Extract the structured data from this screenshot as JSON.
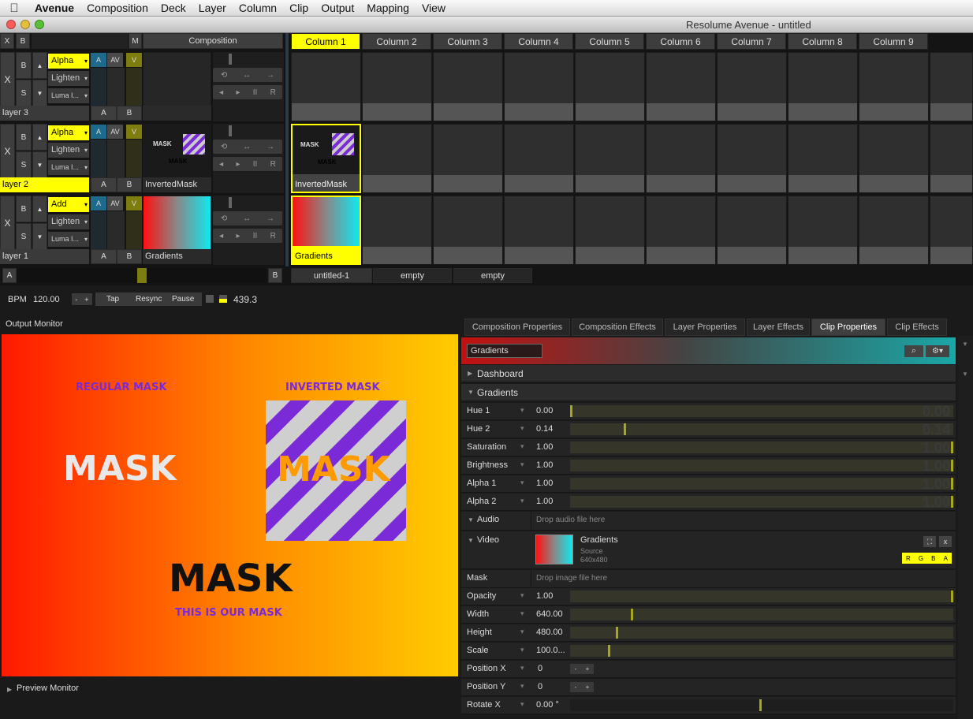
{
  "menubar": {
    "apple_icon": "",
    "app": "Avenue",
    "items": [
      "Composition",
      "Deck",
      "Layer",
      "Column",
      "Clip",
      "Output",
      "Mapping",
      "View"
    ]
  },
  "window": {
    "title": "Resolume Avenue - untitled"
  },
  "deck": {
    "left_header": {
      "x": "X",
      "b": "B",
      "m": "M",
      "composition": "Composition"
    },
    "columns": [
      "Column 1",
      "Column 2",
      "Column 3",
      "Column 4",
      "Column 5",
      "Column 6",
      "Column 7",
      "Column 8",
      "Column 9"
    ],
    "layers": [
      {
        "name": "layer 3",
        "blend": "Alpha",
        "mode": "Lighten",
        "luma": "Luma I...",
        "clip": "",
        "col1": ""
      },
      {
        "name": "layer 2",
        "blend": "Alpha",
        "mode": "Lighten",
        "luma": "Luma I...",
        "clip": "InvertedMask",
        "col1": "InvertedMask"
      },
      {
        "name": "layer 1",
        "blend": "Add",
        "mode": "Lighten",
        "luma": "Luma I...",
        "clip": "Gradients",
        "col1": "Gradients"
      }
    ],
    "layer_btns": {
      "x": "X",
      "b": "B",
      "s": "S",
      "up": "▲",
      "down": "▼",
      "a": "A",
      "av": "AV",
      "v": "V",
      "ab_a": "A",
      "ab_b": "B",
      "trans_loop": "⟲",
      "trans_bounce": "↔",
      "trans_fwd": "→",
      "trans_back": "◂",
      "trans_play": "▸",
      "trans_pause": "II",
      "trans_r": "R",
      "blend_arrow": "▾"
    },
    "thumb_mask_text": "MASK",
    "crossfader": {
      "a": "A",
      "b": "B"
    },
    "deck_tabs": [
      "untitled-1",
      "empty",
      "empty"
    ]
  },
  "bpm": {
    "label": "BPM",
    "value": "120.00",
    "minus": "-",
    "plus": "+",
    "tap": "Tap",
    "resync": "Resync",
    "pause": "Pause",
    "position": "439.3"
  },
  "output": {
    "title": "Output Monitor",
    "regular": "REGULAR MASK",
    "inverted": "INVERTED MASK",
    "mask": "MASK",
    "tagline": "THIS IS OUR MASK",
    "preview": "Preview Monitor"
  },
  "props": {
    "tabs": [
      "Composition Properties",
      "Composition Effects",
      "Layer Properties",
      "Layer Effects",
      "Clip Properties",
      "Clip Effects"
    ],
    "clip_name": "Gradients",
    "search_icon": "⌕",
    "gear_icon": "⚙▾",
    "dashboard": "Dashboard",
    "gradients": "Gradients",
    "params": [
      {
        "name": "Hue 1",
        "value": "0.00",
        "ghost": "0.00",
        "level": 0.0
      },
      {
        "name": "Hue 2",
        "value": "0.14",
        "ghost": "0.14",
        "level": 0.14
      },
      {
        "name": "Saturation",
        "value": "1.00",
        "ghost": "1.00",
        "level": 1.0
      },
      {
        "name": "Brightness",
        "value": "1.00",
        "ghost": "1.00",
        "level": 1.0
      },
      {
        "name": "Alpha 1",
        "value": "1.00",
        "ghost": "1.00",
        "level": 1.0
      },
      {
        "name": "Alpha 2",
        "value": "1.00",
        "ghost": "1.00",
        "level": 1.0
      }
    ],
    "audio": "Audio",
    "audio_drop": "Drop audio file here",
    "video": "Video",
    "video_name": "Gradients",
    "video_source": "Source",
    "video_size": "640x480",
    "rgba": [
      "R",
      "G",
      "B",
      "A"
    ],
    "fit_icon": "⛶",
    "close_icon": "x",
    "mask": "Mask",
    "mask_drop": "Drop image file here",
    "transform": [
      {
        "name": "Opacity",
        "value": "1.00",
        "level": 1.0
      },
      {
        "name": "Width",
        "value": "640.00",
        "level": 0.16
      },
      {
        "name": "Height",
        "value": "480.00",
        "level": 0.12
      },
      {
        "name": "Scale",
        "value": "100.0...",
        "level": 0.1
      }
    ],
    "position": [
      {
        "name": "Position X",
        "value": "0"
      },
      {
        "name": "Position Y",
        "value": "0"
      }
    ],
    "rotate": {
      "name": "Rotate X",
      "value": "0.00 °",
      "level": 0.5
    },
    "arrow": "▾",
    "expand": "▶",
    "collapse": "▼",
    "pm_minus": "-",
    "pm_plus": "+"
  }
}
